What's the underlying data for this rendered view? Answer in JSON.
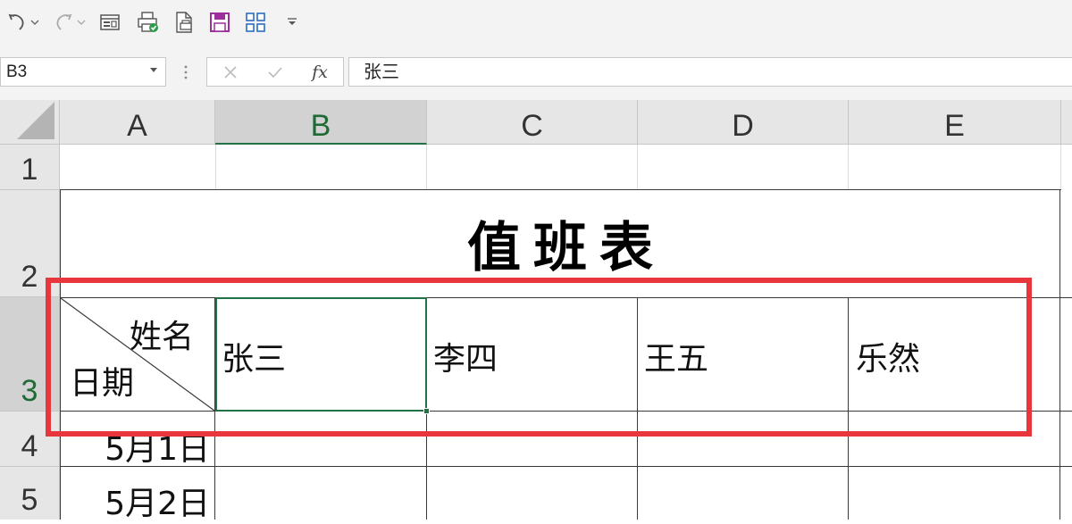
{
  "toolbar": {
    "icons": [
      "undo-icon",
      "redo-icon",
      "form-icon",
      "print-preview-icon",
      "print-icon",
      "save-icon",
      "grid-icon",
      "customize-icon"
    ]
  },
  "formula_bar": {
    "name_box": "B3",
    "fx_label": "fx",
    "content": "张三"
  },
  "columns": [
    "A",
    "B",
    "C",
    "D",
    "E"
  ],
  "rows": [
    "1",
    "2",
    "3",
    "4",
    "5"
  ],
  "sheet": {
    "title": "值班表",
    "header_top": "姓名",
    "header_bottom": "日期",
    "names": [
      "张三",
      "李四",
      "王五",
      "乐然"
    ],
    "dates": [
      "5月1日",
      "5月2日"
    ]
  },
  "selection": {
    "cell": "B3",
    "accent": "#217346",
    "highlight_color": "#e8363d"
  }
}
